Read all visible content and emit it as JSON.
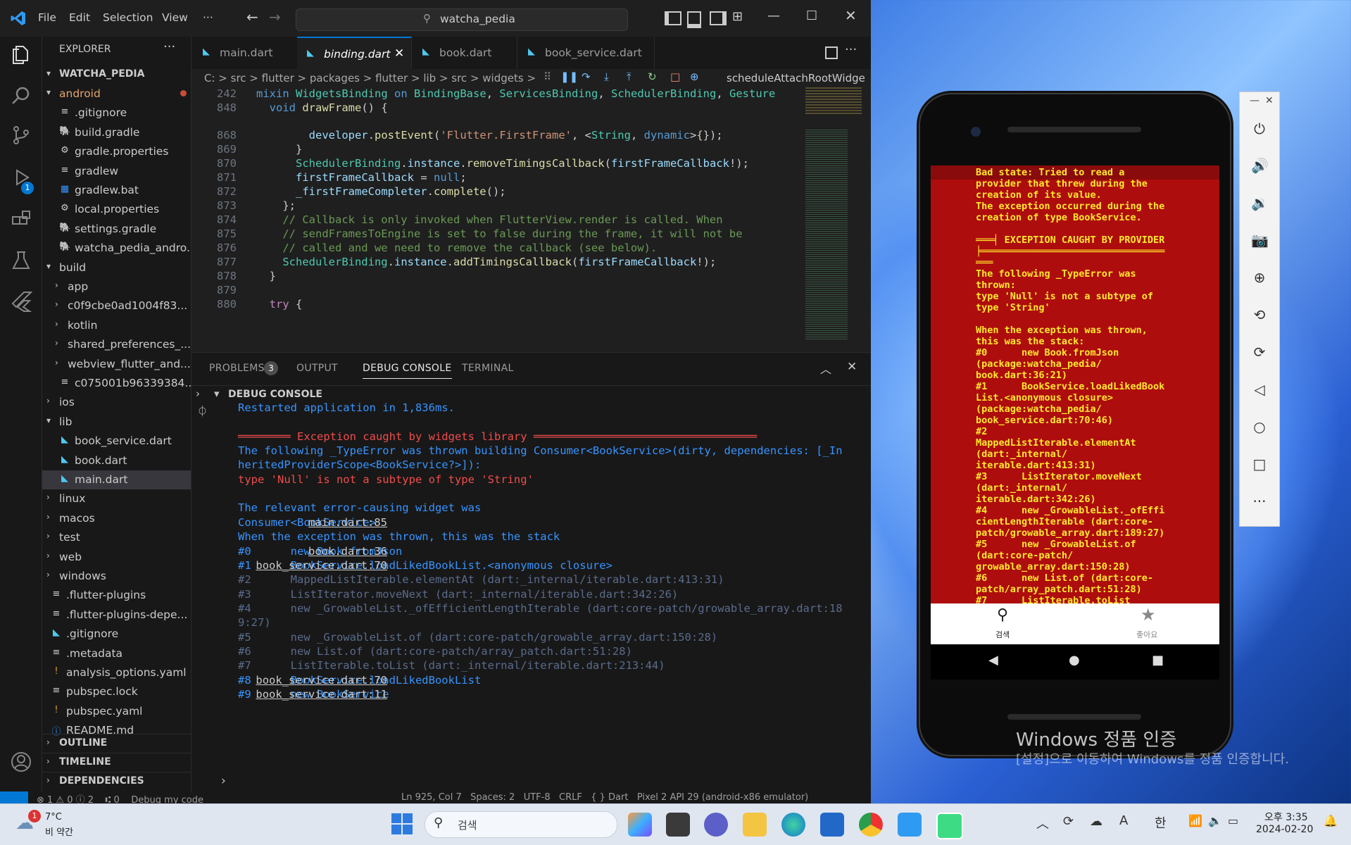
{
  "window": {
    "menu": [
      "File",
      "Edit",
      "Selection",
      "View",
      "···"
    ],
    "search": "watcha_pedia"
  },
  "explorer": {
    "title": "EXPLORER",
    "root": "WATCHA_PEDIA",
    "items": [
      {
        "label": "android",
        "type": "folder-open",
        "depth": 1
      },
      {
        "label": ".gitignore",
        "type": "file",
        "depth": 2
      },
      {
        "label": "build.gradle",
        "type": "gradle",
        "depth": 2
      },
      {
        "label": "gradle.properties",
        "type": "gear",
        "depth": 2
      },
      {
        "label": "gradlew",
        "type": "file",
        "depth": 2
      },
      {
        "label": "gradlew.bat",
        "type": "win",
        "depth": 2
      },
      {
        "label": "local.properties",
        "type": "gear",
        "depth": 2
      },
      {
        "label": "settings.gradle",
        "type": "gradle",
        "depth": 2
      },
      {
        "label": "watcha_pedia_andro...",
        "type": "gradle",
        "depth": 2
      },
      {
        "label": "build",
        "type": "folder-open",
        "depth": 1
      },
      {
        "label": "app",
        "type": "folder",
        "depth": 2
      },
      {
        "label": "c0f9cbe0ad1004f83...",
        "type": "folder",
        "depth": 2
      },
      {
        "label": "kotlin",
        "type": "folder",
        "depth": 2
      },
      {
        "label": "shared_preferences_...",
        "type": "folder",
        "depth": 2
      },
      {
        "label": "webview_flutter_and...",
        "type": "folder",
        "depth": 2
      },
      {
        "label": "c075001b96339384...",
        "type": "file",
        "depth": 2
      },
      {
        "label": "ios",
        "type": "folder",
        "depth": 1
      },
      {
        "label": "lib",
        "type": "folder-open",
        "depth": 1
      },
      {
        "label": "book_service.dart",
        "type": "dart",
        "depth": 2
      },
      {
        "label": "book.dart",
        "type": "dart",
        "depth": 2
      },
      {
        "label": "main.dart",
        "type": "dart",
        "depth": 2,
        "selected": true
      },
      {
        "label": "linux",
        "type": "folder",
        "depth": 1
      },
      {
        "label": "macos",
        "type": "folder",
        "depth": 1
      },
      {
        "label": "test",
        "type": "folder",
        "depth": 1
      },
      {
        "label": "web",
        "type": "folder",
        "depth": 1
      },
      {
        "label": "windows",
        "type": "folder",
        "depth": 1
      },
      {
        "label": ".flutter-plugins",
        "type": "file",
        "depth": 1
      },
      {
        "label": ".flutter-plugins-depe...",
        "type": "file",
        "depth": 1
      },
      {
        "label": ".gitignore",
        "type": "dart",
        "depth": 1
      },
      {
        "label": ".metadata",
        "type": "file",
        "depth": 1
      },
      {
        "label": "analysis_options.yaml",
        "type": "yaml",
        "depth": 1
      },
      {
        "label": "pubspec.lock",
        "type": "file",
        "depth": 1
      },
      {
        "label": "pubspec.yaml",
        "type": "yaml",
        "depth": 1
      },
      {
        "label": "README.md",
        "type": "info",
        "depth": 1
      }
    ],
    "sections": [
      "OUTLINE",
      "TIMELINE",
      "DEPENDENCIES"
    ]
  },
  "tabs": [
    {
      "label": "main.dart",
      "active": false
    },
    {
      "label": "binding.dart",
      "active": true
    },
    {
      "label": "book.dart",
      "active": false
    },
    {
      "label": "book_service.dart",
      "active": false
    }
  ],
  "breadcrumb": "C: > src > flutter > packages > flutter > lib > src > widgets >",
  "breadcrumb_tail": "scheduleAttachRootWidge",
  "code": [
    {
      "n": "242",
      "html": "<span class='kw'>mixin</span> <span class='ty'>WidgetsBinding</span> <span class='kw'>on</span> <span class='ty'>BindingBase</span>, <span class='ty'>ServicesBinding</span>, <span class='ty'>SchedulerBinding</span>, <span class='ty'>Gesture</span>"
    },
    {
      "n": "848",
      "html": "  <span class='kw'>void</span> <span class='fn'>drawFrame</span>() {"
    },
    {
      "n": "868",
      "html": "        <span class='va'>developer</span>.<span class='fn'>postEvent</span>(<span class='str'>'Flutter.FirstFrame'</span>, &lt;<span class='ty'>String</span>, <span class='kw'>dynamic</span>&gt;{});"
    },
    {
      "n": "869",
      "html": "      }"
    },
    {
      "n": "870",
      "html": "      <span class='ty'>SchedulerBinding</span>.<span class='va'>instance</span>.<span class='fn'>removeTimingsCallback</span>(<span class='va'>firstFrameCallback</span>!);"
    },
    {
      "n": "871",
      "html": "      <span class='va'>firstFrameCallback</span> = <span class='kw'>null</span>;"
    },
    {
      "n": "872",
      "html": "      <span class='va'>_firstFrameCompleter</span>.<span class='fn'>complete</span>();"
    },
    {
      "n": "873",
      "html": "    };"
    },
    {
      "n": "874",
      "html": "    <span class='cm'>// Callback is only invoked when FlutterView.render is called. When</span>"
    },
    {
      "n": "875",
      "html": "    <span class='cm'>// sendFramesToEngine is set to false during the frame, it will not be</span>"
    },
    {
      "n": "876",
      "html": "    <span class='cm'>// called and we need to remove the callback (see below).</span>"
    },
    {
      "n": "877",
      "html": "    <span class='ty'>SchedulerBinding</span>.<span class='va'>instance</span>.<span class='fn'>addTimingsCallback</span>(<span class='va'>firstFrameCallback</span>!);"
    },
    {
      "n": "878",
      "html": "  }"
    },
    {
      "n": "879",
      "html": ""
    },
    {
      "n": "880",
      "html": "  <span class='kw2'>try</span> {"
    }
  ],
  "panel": {
    "tabs": [
      "PROBLEMS",
      "OUTPUT",
      "DEBUG CONSOLE",
      "TERMINAL"
    ],
    "problems_count": "3",
    "section": "DEBUG CONSOLE",
    "lines": [
      {
        "t": "Restarted application in 1,836ms.",
        "c": "blue"
      },
      {
        "t": "",
        "c": ""
      },
      {
        "t": "════════ Exception caught by widgets library ══════════════════════════════════",
        "c": "red"
      },
      {
        "t": "The following _TypeError was thrown building Consumer<BookService>(dirty, dependencies: [_In",
        "c": "blue"
      },
      {
        "t": "heritedProviderScope<BookService?>]):",
        "c": "blue"
      },
      {
        "t": "type 'Null' is not a subtype of type 'String'",
        "c": "red"
      },
      {
        "t": "",
        "c": ""
      },
      {
        "t": "The relevant error-causing widget was",
        "c": "blue"
      },
      {
        "t": "Consumer<BookService>",
        "c": "blue",
        "link": "main.dart:85"
      },
      {
        "t": "When the exception was thrown, this was the stack",
        "c": "blue"
      },
      {
        "t": "#0      new Book.fromJson",
        "c": "blue",
        "link": "book.dart:36"
      },
      {
        "t": "#1      BookService.loadLikedBookList.<anonymous closure>",
        "c": "blue",
        "link": "book_service.dart:70"
      },
      {
        "t": "#2      MappedListIterable.elementAt (dart:_internal/iterable.dart:413:31)",
        "c": "dim"
      },
      {
        "t": "#3      ListIterator.moveNext (dart:_internal/iterable.dart:342:26)",
        "c": "dim"
      },
      {
        "t": "#4      new _GrowableList._ofEfficientLengthIterable (dart:core-patch/growable_array.dart:18",
        "c": "dim"
      },
      {
        "t": "9:27)",
        "c": "dim"
      },
      {
        "t": "#5      new _GrowableList.of (dart:core-patch/growable_array.dart:150:28)",
        "c": "dim"
      },
      {
        "t": "#6      new List.of (dart:core-patch/array_patch.dart:51:28)",
        "c": "dim"
      },
      {
        "t": "#7      ListIterable.toList (dart:_internal/iterable.dart:213:44)",
        "c": "dim"
      },
      {
        "t": "#8      BookService.loadLikedBookList",
        "c": "blue",
        "link": "book_service.dart:70"
      },
      {
        "t": "#9      new BookService",
        "c": "blue",
        "link": "book_service.dart:11"
      }
    ]
  },
  "statusbar": {
    "left": "⊗ 1 ⚠ 0 ⓘ 2    ⑆ 0    Debug my code",
    "right": "Ln 925, Col 7   Spaces: 2   UTF-8   CRLF   { } Dart   Pixel 2 API 29 (android-x86 emulator)"
  },
  "phone": {
    "error_text": [
      "Bad state: Tried to read a",
      "provider that threw during the",
      "creation of its value.",
      "The exception occurred during the",
      "creation of type BookService.",
      "",
      "═══╡ EXCEPTION CAUGHT BY PROVIDER",
      "╞════════════════════════════════",
      "═══",
      "The following _TypeError was",
      "thrown:",
      "type 'Null' is not a subtype of",
      "type 'String'",
      "",
      "When the exception was thrown,",
      "this was the stack:",
      "#0      new Book.fromJson",
      "(package:watcha_pedia/",
      "book.dart:36:21)",
      "#1      BookService.loadLikedBook",
      "List.<anonymous closure>",
      "(package:watcha_pedia/",
      "book_service.dart:70:46)",
      "#2",
      "MappedListIterable.elementAt",
      "(dart:_internal/",
      "iterable.dart:413:31)",
      "#3      ListIterator.moveNext",
      "(dart:_internal/",
      "iterable.dart:342:26)",
      "#4      new _GrowableList._ofEffi",
      "cientLengthIterable (dart:core-",
      "patch/growable_array.dart:189:27)",
      "#5      new _GrowableList.of",
      "(dart:core-patch/",
      "growable_array.dart:150:28)",
      "#6      new List.of (dart:core-",
      "patch/array_patch.dart:51:28)",
      "#7      ListIterable.toList"
    ],
    "nav": [
      {
        "label": "검색"
      },
      {
        "label": "좋아요"
      }
    ]
  },
  "watermark": {
    "line1": "Windows 정품 인증",
    "line2": "[설정]으로 이동하여 Windows를 정품 인증합니다."
  },
  "taskbar": {
    "weather_temp": "7°C",
    "weather_desc": "비 약간",
    "badge": "1",
    "search": "검색",
    "time": "오후 3:35",
    "date": "2024-02-20",
    "lang": "한",
    "font_ind": "A"
  }
}
